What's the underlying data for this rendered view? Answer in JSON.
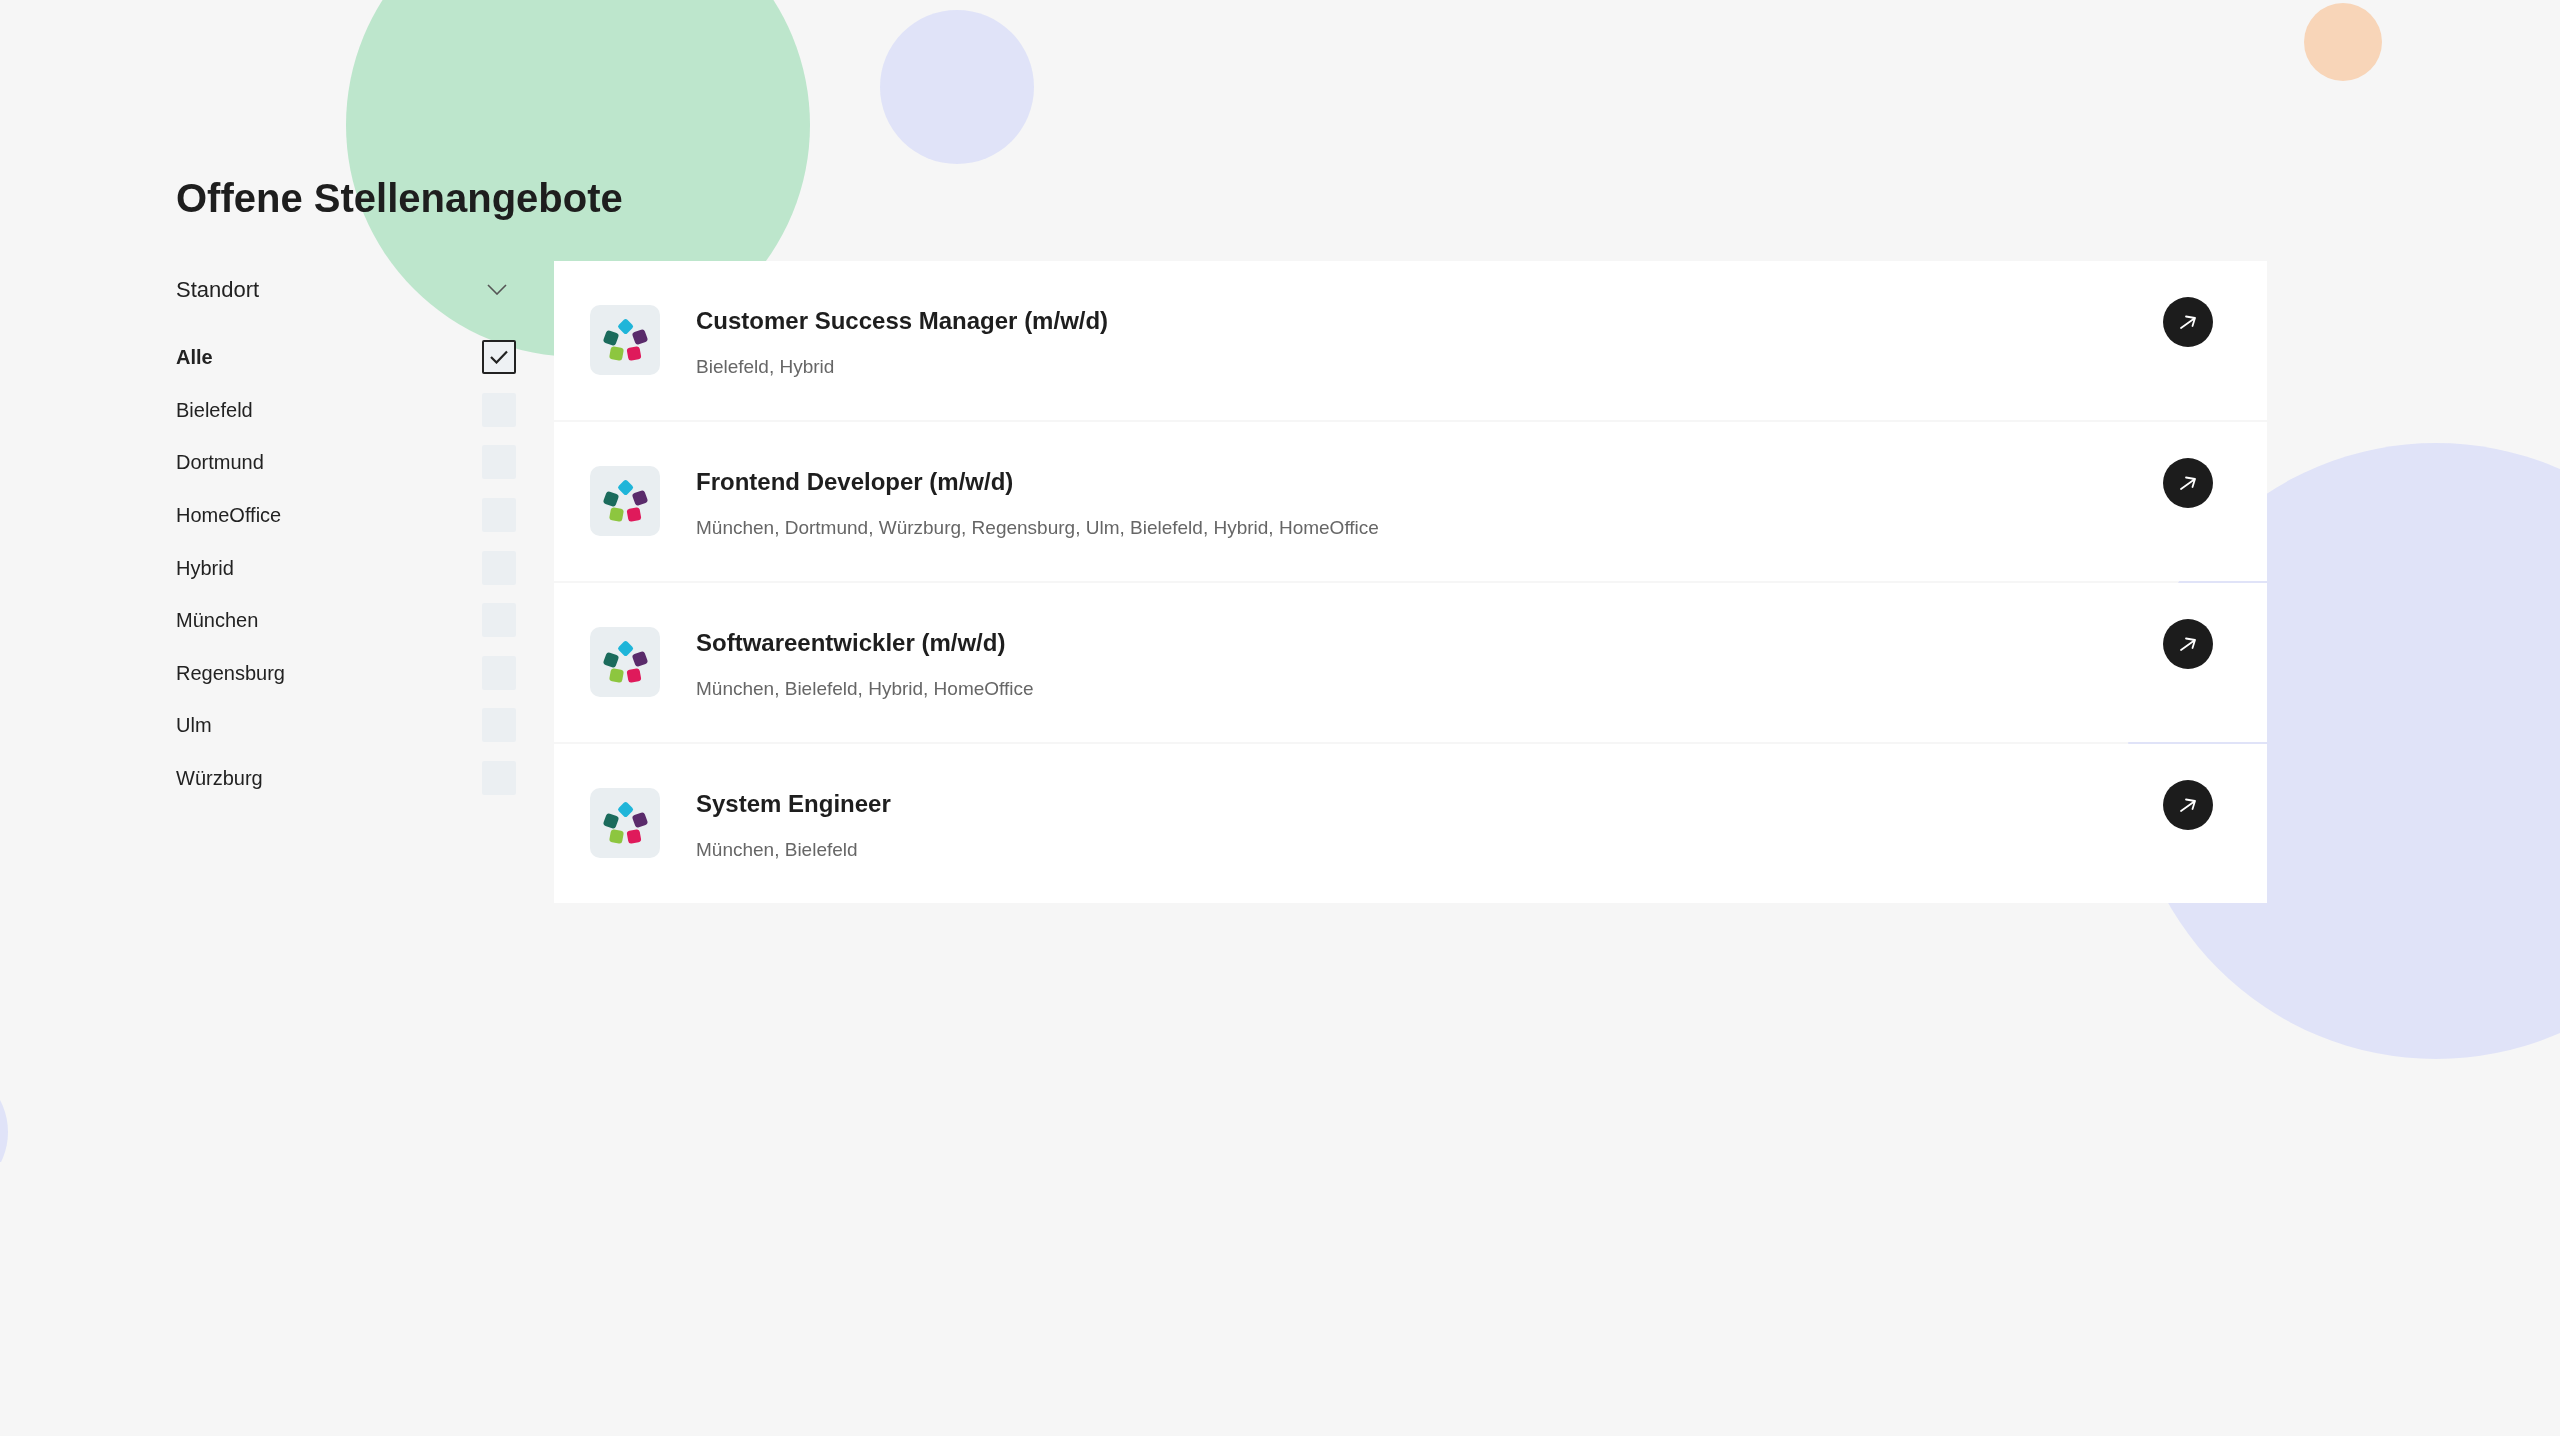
{
  "page": {
    "title": "Offene Stellenangebote"
  },
  "filter": {
    "label": "Standort",
    "options": [
      {
        "label": "Alle",
        "checked": true
      },
      {
        "label": "Bielefeld",
        "checked": false
      },
      {
        "label": "Dortmund",
        "checked": false
      },
      {
        "label": "HomeOffice",
        "checked": false
      },
      {
        "label": "Hybrid",
        "checked": false
      },
      {
        "label": "München",
        "checked": false
      },
      {
        "label": "Regensburg",
        "checked": false
      },
      {
        "label": "Ulm",
        "checked": false
      },
      {
        "label": "Würzburg",
        "checked": false
      }
    ]
  },
  "jobs": [
    {
      "title": "Customer Success Manager (m/w/d)",
      "locations": "Bielefeld, Hybrid"
    },
    {
      "title": "Frontend Developer (m/w/d)",
      "locations": "München, Dortmund, Würzburg, Regensburg, Ulm, Bielefeld, Hybrid, HomeOffice"
    },
    {
      "title": "Softwareentwickler (m/w/d)",
      "locations": "München, Bielefeld, Hybrid, HomeOffice"
    },
    {
      "title": "System Engineer",
      "locations": "München, Bielefeld"
    }
  ]
}
